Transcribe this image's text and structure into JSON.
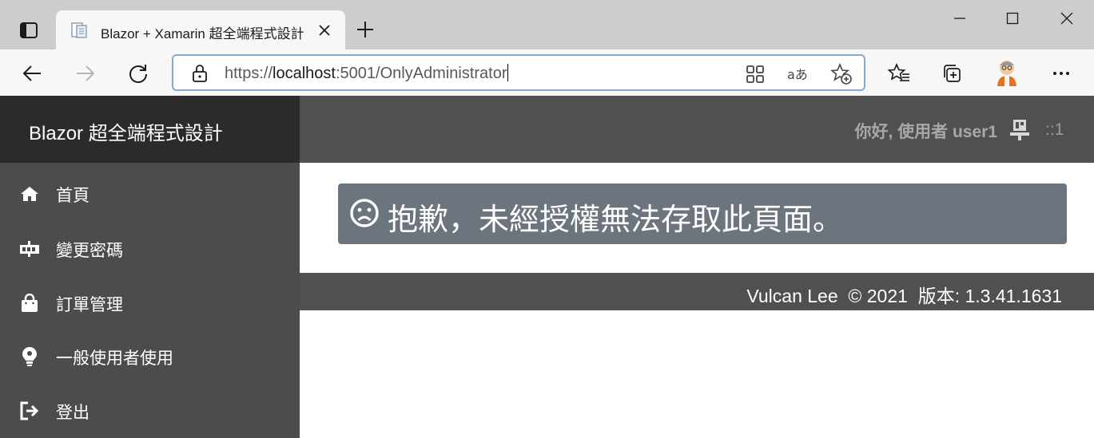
{
  "browser": {
    "tab_title": "Blazor + Xamarin 超全端程式設計",
    "url_prefix": "https://",
    "url_host": "localhost",
    "url_rest": ":5001/OnlyAdministrator",
    "icons": {
      "tab_actions": "tab-actions-icon",
      "favicon": "page-favicon-icon",
      "close_tab": "close-icon",
      "new_tab": "plus-icon",
      "minimize": "minimize-icon",
      "maximize": "maximize-icon",
      "close_window": "close-icon",
      "back": "back-arrow-icon",
      "forward": "forward-arrow-icon",
      "refresh": "refresh-icon",
      "lock": "lock-icon",
      "app_available": "app-grid-icon",
      "read_aloud": "read-aloud-icon",
      "add_favorite": "star-plus-icon",
      "favorites": "favorites-list-icon",
      "collections": "collections-icon",
      "profile": "profile-avatar",
      "menu": "more-icon"
    }
  },
  "app": {
    "brand": "Blazor 超全端程式設計",
    "nav": [
      {
        "label": "首頁",
        "icon": "home-icon"
      },
      {
        "label": "變更密碼",
        "icon": "key-icon"
      },
      {
        "label": "訂單管理",
        "icon": "shopping-bag-icon"
      },
      {
        "label": "一般使用者使用",
        "icon": "user-bulb-icon"
      },
      {
        "label": "登出",
        "icon": "sign-out-icon"
      }
    ],
    "greeting": "你好, 使用者 user1",
    "user_icon": "user-desk-icon",
    "ip": "::1",
    "alert_icon": "frown-icon",
    "alert_text": "抱歉，未經授權無法存取此頁面。",
    "footer": "Vulcan Lee  © 2021  版本: 1.3.41.1631"
  },
  "colors": {
    "sidebar": "#4c4c4c",
    "brand_bar": "#2b2b2b",
    "topbar": "#505050",
    "alert": "#6c757d",
    "address_focus": "#86a9d2"
  }
}
